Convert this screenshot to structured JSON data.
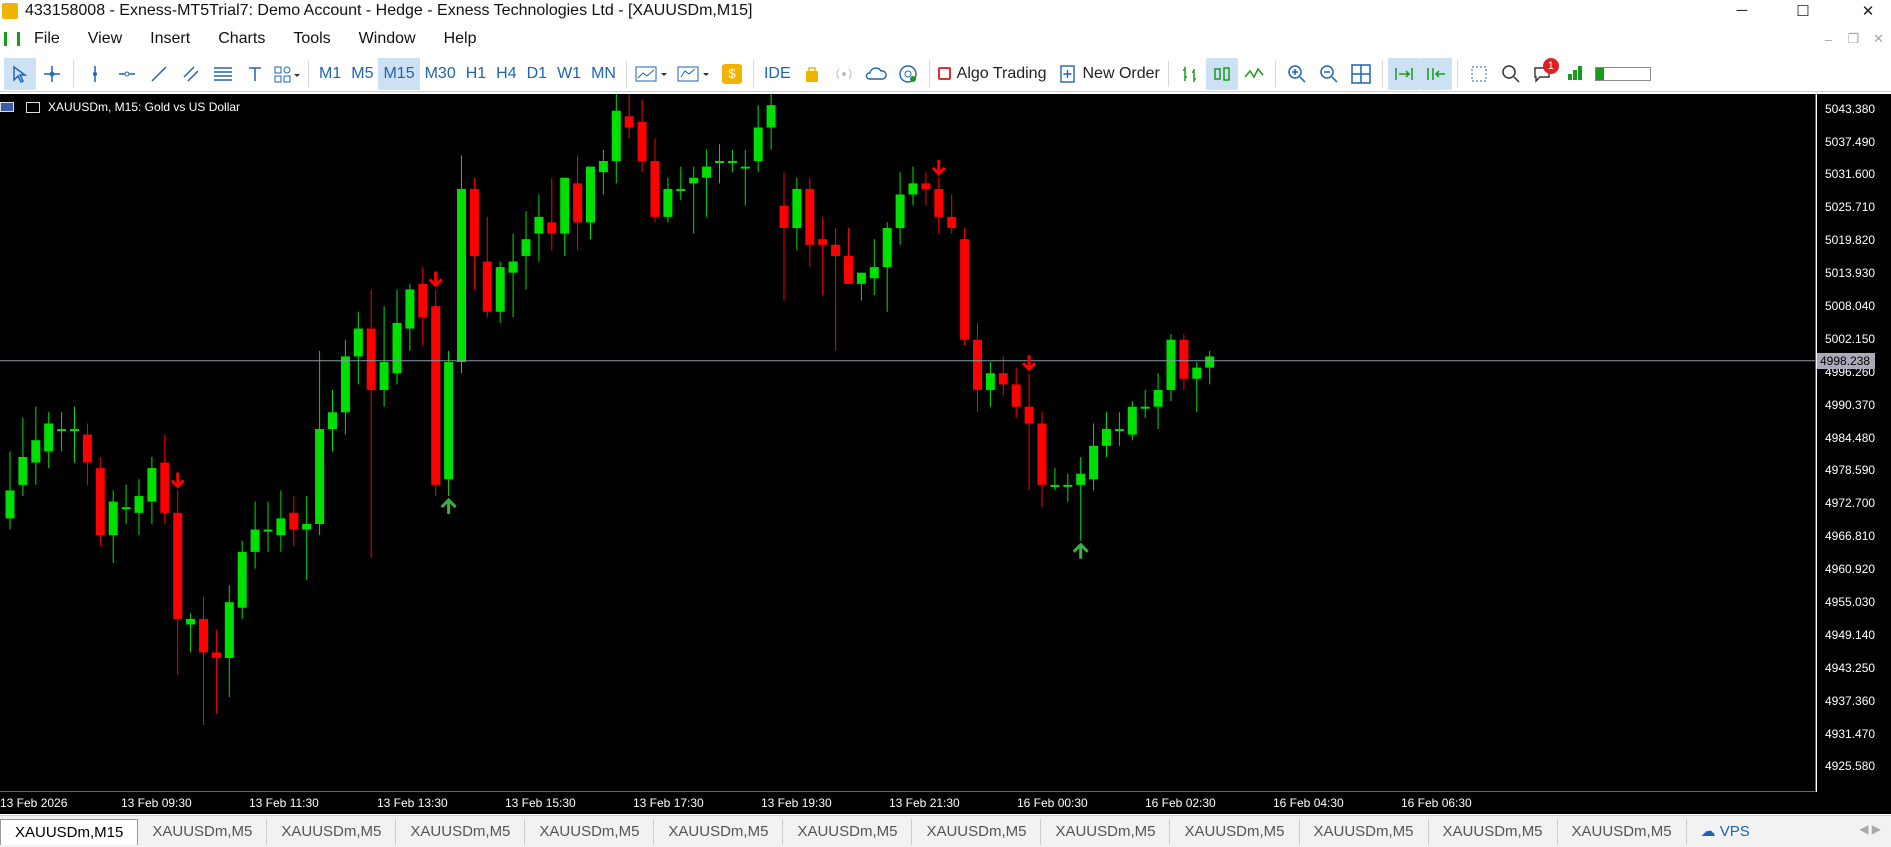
{
  "window": {
    "title": "433158008 - Exness-MT5Trial7: Demo Account - Hedge - Exness Technologies Ltd - [XAUUSDm,M15]",
    "minimize": "─",
    "maximize": "☐",
    "close": "✕"
  },
  "menu": [
    "File",
    "View",
    "Insert",
    "Charts",
    "Tools",
    "Window",
    "Help"
  ],
  "menu_controls": [
    "–",
    "❐",
    "✕"
  ],
  "toolbar": {
    "timeframes": [
      "M1",
      "M5",
      "M15",
      "M30",
      "H1",
      "H4",
      "D1",
      "W1",
      "MN"
    ],
    "active_timeframe": "M15",
    "ide_label": "IDE",
    "algo_trading_label": "Algo Trading",
    "new_order_label": "New Order",
    "notification_count": "1"
  },
  "chart": {
    "header": "XAUUSDm, M15:  Gold vs US Dollar",
    "bid_price": "4998.238",
    "price_labels": [
      "5043.380",
      "5037.490",
      "5031.600",
      "5025.710",
      "5019.820",
      "5013.930",
      "5008.040",
      "5002.150",
      "4996.260",
      "4990.370",
      "4984.480",
      "4978.590",
      "4972.700",
      "4966.810",
      "4960.920",
      "4955.030",
      "4949.140",
      "4943.250",
      "4937.360",
      "4931.470",
      "4925.580"
    ],
    "time_labels": [
      "13 Feb 2026",
      "13 Feb 09:30",
      "13 Feb 11:30",
      "13 Feb 13:30",
      "13 Feb 15:30",
      "13 Feb 17:30",
      "13 Feb 19:30",
      "13 Feb 21:30",
      "16 Feb 00:30",
      "16 Feb 02:30",
      "16 Feb 04:30",
      "16 Feb 06:30"
    ],
    "colors": {
      "bull": "#00e000",
      "bear": "#ff0000",
      "background": "#000000",
      "bid_line": "#8899aa"
    }
  },
  "chart_data": {
    "type": "candlestick",
    "title": "XAUUSDm, M15:  Gold vs US Dollar",
    "ylim": [
      4921,
      5046
    ],
    "candles": [
      {
        "o": 4970,
        "h": 4982,
        "l": 4968,
        "c": 4975
      },
      {
        "o": 4976,
        "h": 4988,
        "l": 4974,
        "c": 4981
      },
      {
        "o": 4980,
        "h": 4990,
        "l": 4976,
        "c": 4984
      },
      {
        "o": 4982,
        "h": 4989,
        "l": 4979,
        "c": 4987
      },
      {
        "o": 4986,
        "h": 4989,
        "l": 4982,
        "c": 4986
      },
      {
        "o": 4986,
        "h": 4990,
        "l": 4980,
        "c": 4986
      },
      {
        "o": 4985,
        "h": 4987,
        "l": 4976,
        "c": 4980
      },
      {
        "o": 4979,
        "h": 4981,
        "l": 4965,
        "c": 4967
      },
      {
        "o": 4967,
        "h": 4975,
        "l": 4962,
        "c": 4973
      },
      {
        "o": 4972,
        "h": 4976,
        "l": 4969,
        "c": 4972
      },
      {
        "o": 4971,
        "h": 4977,
        "l": 4967,
        "c": 4974
      },
      {
        "o": 4973,
        "h": 4981,
        "l": 4969,
        "c": 4979
      },
      {
        "o": 4980,
        "h": 4985,
        "l": 4969,
        "c": 4971
      },
      {
        "o": 4971,
        "h": 4975,
        "l": 4942,
        "c": 4952
      },
      {
        "o": 4951,
        "h": 4953,
        "l": 4946,
        "c": 4952
      },
      {
        "o": 4952,
        "h": 4956,
        "l": 4933,
        "c": 4946
      },
      {
        "o": 4946,
        "h": 4950,
        "l": 4935,
        "c": 4945
      },
      {
        "o": 4945,
        "h": 4958,
        "l": 4938,
        "c": 4955
      },
      {
        "o": 4954,
        "h": 4966,
        "l": 4952,
        "c": 4964
      },
      {
        "o": 4964,
        "h": 4973,
        "l": 4961,
        "c": 4968
      },
      {
        "o": 4968,
        "h": 4973,
        "l": 4964,
        "c": 4968
      },
      {
        "o": 4967,
        "h": 4975,
        "l": 4964,
        "c": 4970
      },
      {
        "o": 4971,
        "h": 4974,
        "l": 4965,
        "c": 4968
      },
      {
        "o": 4968,
        "h": 4974,
        "l": 4959,
        "c": 4969
      },
      {
        "o": 4969,
        "h": 5000,
        "l": 4967,
        "c": 4986
      },
      {
        "o": 4986,
        "h": 4993,
        "l": 4982,
        "c": 4989
      },
      {
        "o": 4989,
        "h": 5002,
        "l": 4985,
        "c": 4999
      },
      {
        "o": 4999,
        "h": 5007,
        "l": 4994,
        "c": 5004
      },
      {
        "o": 5004,
        "h": 5011,
        "l": 4963,
        "c": 4993
      },
      {
        "o": 4993,
        "h": 5008,
        "l": 4990,
        "c": 4998
      },
      {
        "o": 4996,
        "h": 5011,
        "l": 4994,
        "c": 5005
      },
      {
        "o": 5004,
        "h": 5012,
        "l": 5000,
        "c": 5011
      },
      {
        "o": 5012,
        "h": 5015,
        "l": 5001,
        "c": 5006
      },
      {
        "o": 5008,
        "h": 5011,
        "l": 4974,
        "c": 4976
      },
      {
        "o": 4977,
        "h": 5000,
        "l": 4974,
        "c": 4998
      },
      {
        "o": 4998,
        "h": 5035,
        "l": 4996,
        "c": 5029
      },
      {
        "o": 5029,
        "h": 5031,
        "l": 5011,
        "c": 5017
      },
      {
        "o": 5016,
        "h": 5024,
        "l": 5006,
        "c": 5007
      },
      {
        "o": 5007,
        "h": 5016,
        "l": 5005,
        "c": 5015
      },
      {
        "o": 5014,
        "h": 5021,
        "l": 5006,
        "c": 5016
      },
      {
        "o": 5017,
        "h": 5025,
        "l": 5011,
        "c": 5020
      },
      {
        "o": 5021,
        "h": 5028,
        "l": 5016,
        "c": 5024
      },
      {
        "o": 5023,
        "h": 5031,
        "l": 5018,
        "c": 5021
      },
      {
        "o": 5021,
        "h": 5031,
        "l": 5017,
        "c": 5031
      },
      {
        "o": 5030,
        "h": 5035,
        "l": 5018,
        "c": 5023
      },
      {
        "o": 5023,
        "h": 5033,
        "l": 5020,
        "c": 5033
      },
      {
        "o": 5032,
        "h": 5036,
        "l": 5028,
        "c": 5034
      },
      {
        "o": 5034,
        "h": 5046,
        "l": 5030,
        "c": 5043
      },
      {
        "o": 5042,
        "h": 5046,
        "l": 5038,
        "c": 5040
      },
      {
        "o": 5041,
        "h": 5045,
        "l": 5032,
        "c": 5034
      },
      {
        "o": 5034,
        "h": 5038,
        "l": 5023,
        "c": 5024
      },
      {
        "o": 5024,
        "h": 5031,
        "l": 5023,
        "c": 5029
      },
      {
        "o": 5029,
        "h": 5033,
        "l": 5027,
        "c": 5029
      },
      {
        "o": 5030,
        "h": 5033,
        "l": 5021,
        "c": 5031
      },
      {
        "o": 5031,
        "h": 5036,
        "l": 5024,
        "c": 5033
      },
      {
        "o": 5034,
        "h": 5037,
        "l": 5030,
        "c": 5034
      },
      {
        "o": 5034,
        "h": 5036,
        "l": 5032,
        "c": 5034
      },
      {
        "o": 5033,
        "h": 5036,
        "l": 5026,
        "c": 5033
      },
      {
        "o": 5034,
        "h": 5044,
        "l": 5032,
        "c": 5040
      },
      {
        "o": 5040,
        "h": 5046,
        "l": 5036,
        "c": 5044
      },
      {
        "o": 5026,
        "h": 5032,
        "l": 5009,
        "c": 5022
      },
      {
        "o": 5022,
        "h": 5031,
        "l": 5018,
        "c": 5029
      },
      {
        "o": 5029,
        "h": 5031,
        "l": 5015,
        "c": 5019
      },
      {
        "o": 5020,
        "h": 5024,
        "l": 5010,
        "c": 5019
      },
      {
        "o": 5019,
        "h": 5022,
        "l": 5000,
        "c": 5017
      },
      {
        "o": 5017,
        "h": 5022,
        "l": 5012,
        "c": 5012
      },
      {
        "o": 5012,
        "h": 5014,
        "l": 5009,
        "c": 5014
      },
      {
        "o": 5013,
        "h": 5020,
        "l": 5010,
        "c": 5015
      },
      {
        "o": 5015,
        "h": 5023,
        "l": 5007,
        "c": 5022
      },
      {
        "o": 5022,
        "h": 5032,
        "l": 5019,
        "c": 5028
      },
      {
        "o": 5028,
        "h": 5033,
        "l": 5026,
        "c": 5030
      },
      {
        "o": 5030,
        "h": 5032,
        "l": 5026,
        "c": 5029
      },
      {
        "o": 5029,
        "h": 5031,
        "l": 5021,
        "c": 5024
      },
      {
        "o": 5024,
        "h": 5028,
        "l": 5021,
        "c": 5022
      },
      {
        "o": 5020,
        "h": 5022,
        "l": 5001,
        "c": 5002
      },
      {
        "o": 5002,
        "h": 5005,
        "l": 4989,
        "c": 4993
      },
      {
        "o": 4993,
        "h": 4998,
        "l": 4990,
        "c": 4996
      },
      {
        "o": 4996,
        "h": 4999,
        "l": 4992,
        "c": 4994
      },
      {
        "o": 4994,
        "h": 4997,
        "l": 4988,
        "c": 4990
      },
      {
        "o": 4990,
        "h": 4996,
        "l": 4975,
        "c": 4987
      },
      {
        "o": 4987,
        "h": 4989,
        "l": 4972,
        "c": 4976
      },
      {
        "o": 4976,
        "h": 4979,
        "l": 4975,
        "c": 4976
      },
      {
        "o": 4976,
        "h": 4978,
        "l": 4973,
        "c": 4976
      },
      {
        "o": 4976,
        "h": 4981,
        "l": 4966,
        "c": 4978
      },
      {
        "o": 4977,
        "h": 4987,
        "l": 4975,
        "c": 4983
      },
      {
        "o": 4983,
        "h": 4989,
        "l": 4981,
        "c": 4986
      },
      {
        "o": 4986,
        "h": 4989,
        "l": 4983,
        "c": 4986
      },
      {
        "o": 4985,
        "h": 4991,
        "l": 4984,
        "c": 4990
      },
      {
        "o": 4990,
        "h": 4993,
        "l": 4988,
        "c": 4990
      },
      {
        "o": 4990,
        "h": 4996,
        "l": 4986,
        "c": 4993
      },
      {
        "o": 4993,
        "h": 5003,
        "l": 4991,
        "c": 5002
      },
      {
        "o": 5002,
        "h": 5003,
        "l": 4993,
        "c": 4995
      },
      {
        "o": 4995,
        "h": 4998,
        "l": 4989,
        "c": 4997
      },
      {
        "o": 4997,
        "h": 5000,
        "l": 4994,
        "c": 4999
      }
    ],
    "sell_arrows": [
      13,
      33,
      72,
      79
    ],
    "buy_arrows": [
      34,
      83
    ]
  },
  "tabs": [
    "XAUUSDm,M15",
    "XAUUSDm,M5",
    "XAUUSDm,M5",
    "XAUUSDm,M5",
    "XAUUSDm,M5",
    "XAUUSDm,M5",
    "XAUUSDm,M5",
    "XAUUSDm,M5",
    "XAUUSDm,M5",
    "XAUUSDm,M5",
    "XAUUSDm,M5",
    "XAUUSDm,M5",
    "XAUUSDm,M5",
    "VPS"
  ],
  "tab_scroll": "◀ ▶"
}
